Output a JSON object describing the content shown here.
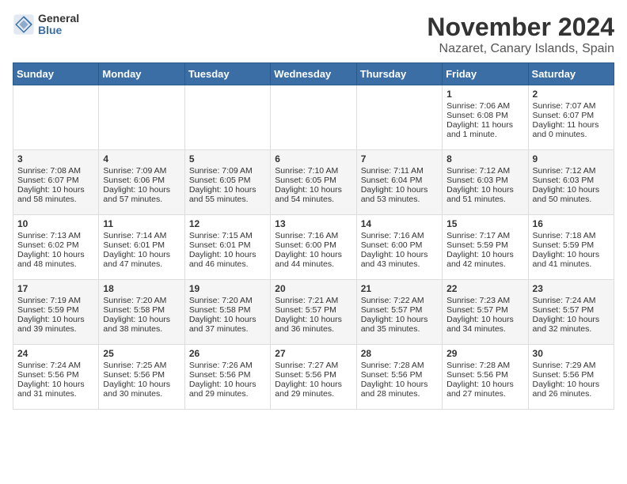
{
  "header": {
    "logo": {
      "line1": "General",
      "line2": "Blue"
    },
    "title": "November 2024",
    "subtitle": "Nazaret, Canary Islands, Spain"
  },
  "days_of_week": [
    "Sunday",
    "Monday",
    "Tuesday",
    "Wednesday",
    "Thursday",
    "Friday",
    "Saturday"
  ],
  "weeks": [
    [
      {
        "day": "",
        "content": ""
      },
      {
        "day": "",
        "content": ""
      },
      {
        "day": "",
        "content": ""
      },
      {
        "day": "",
        "content": ""
      },
      {
        "day": "",
        "content": ""
      },
      {
        "day": "1",
        "content": "Sunrise: 7:06 AM\nSunset: 6:08 PM\nDaylight: 11 hours and 1 minute."
      },
      {
        "day": "2",
        "content": "Sunrise: 7:07 AM\nSunset: 6:07 PM\nDaylight: 11 hours and 0 minutes."
      }
    ],
    [
      {
        "day": "3",
        "content": "Sunrise: 7:08 AM\nSunset: 6:07 PM\nDaylight: 10 hours and 58 minutes."
      },
      {
        "day": "4",
        "content": "Sunrise: 7:09 AM\nSunset: 6:06 PM\nDaylight: 10 hours and 57 minutes."
      },
      {
        "day": "5",
        "content": "Sunrise: 7:09 AM\nSunset: 6:05 PM\nDaylight: 10 hours and 55 minutes."
      },
      {
        "day": "6",
        "content": "Sunrise: 7:10 AM\nSunset: 6:05 PM\nDaylight: 10 hours and 54 minutes."
      },
      {
        "day": "7",
        "content": "Sunrise: 7:11 AM\nSunset: 6:04 PM\nDaylight: 10 hours and 53 minutes."
      },
      {
        "day": "8",
        "content": "Sunrise: 7:12 AM\nSunset: 6:03 PM\nDaylight: 10 hours and 51 minutes."
      },
      {
        "day": "9",
        "content": "Sunrise: 7:12 AM\nSunset: 6:03 PM\nDaylight: 10 hours and 50 minutes."
      }
    ],
    [
      {
        "day": "10",
        "content": "Sunrise: 7:13 AM\nSunset: 6:02 PM\nDaylight: 10 hours and 48 minutes."
      },
      {
        "day": "11",
        "content": "Sunrise: 7:14 AM\nSunset: 6:01 PM\nDaylight: 10 hours and 47 minutes."
      },
      {
        "day": "12",
        "content": "Sunrise: 7:15 AM\nSunset: 6:01 PM\nDaylight: 10 hours and 46 minutes."
      },
      {
        "day": "13",
        "content": "Sunrise: 7:16 AM\nSunset: 6:00 PM\nDaylight: 10 hours and 44 minutes."
      },
      {
        "day": "14",
        "content": "Sunrise: 7:16 AM\nSunset: 6:00 PM\nDaylight: 10 hours and 43 minutes."
      },
      {
        "day": "15",
        "content": "Sunrise: 7:17 AM\nSunset: 5:59 PM\nDaylight: 10 hours and 42 minutes."
      },
      {
        "day": "16",
        "content": "Sunrise: 7:18 AM\nSunset: 5:59 PM\nDaylight: 10 hours and 41 minutes."
      }
    ],
    [
      {
        "day": "17",
        "content": "Sunrise: 7:19 AM\nSunset: 5:59 PM\nDaylight: 10 hours and 39 minutes."
      },
      {
        "day": "18",
        "content": "Sunrise: 7:20 AM\nSunset: 5:58 PM\nDaylight: 10 hours and 38 minutes."
      },
      {
        "day": "19",
        "content": "Sunrise: 7:20 AM\nSunset: 5:58 PM\nDaylight: 10 hours and 37 minutes."
      },
      {
        "day": "20",
        "content": "Sunrise: 7:21 AM\nSunset: 5:57 PM\nDaylight: 10 hours and 36 minutes."
      },
      {
        "day": "21",
        "content": "Sunrise: 7:22 AM\nSunset: 5:57 PM\nDaylight: 10 hours and 35 minutes."
      },
      {
        "day": "22",
        "content": "Sunrise: 7:23 AM\nSunset: 5:57 PM\nDaylight: 10 hours and 34 minutes."
      },
      {
        "day": "23",
        "content": "Sunrise: 7:24 AM\nSunset: 5:57 PM\nDaylight: 10 hours and 32 minutes."
      }
    ],
    [
      {
        "day": "24",
        "content": "Sunrise: 7:24 AM\nSunset: 5:56 PM\nDaylight: 10 hours and 31 minutes."
      },
      {
        "day": "25",
        "content": "Sunrise: 7:25 AM\nSunset: 5:56 PM\nDaylight: 10 hours and 30 minutes."
      },
      {
        "day": "26",
        "content": "Sunrise: 7:26 AM\nSunset: 5:56 PM\nDaylight: 10 hours and 29 minutes."
      },
      {
        "day": "27",
        "content": "Sunrise: 7:27 AM\nSunset: 5:56 PM\nDaylight: 10 hours and 29 minutes."
      },
      {
        "day": "28",
        "content": "Sunrise: 7:28 AM\nSunset: 5:56 PM\nDaylight: 10 hours and 28 minutes."
      },
      {
        "day": "29",
        "content": "Sunrise: 7:28 AM\nSunset: 5:56 PM\nDaylight: 10 hours and 27 minutes."
      },
      {
        "day": "30",
        "content": "Sunrise: 7:29 AM\nSunset: 5:56 PM\nDaylight: 10 hours and 26 minutes."
      }
    ]
  ]
}
